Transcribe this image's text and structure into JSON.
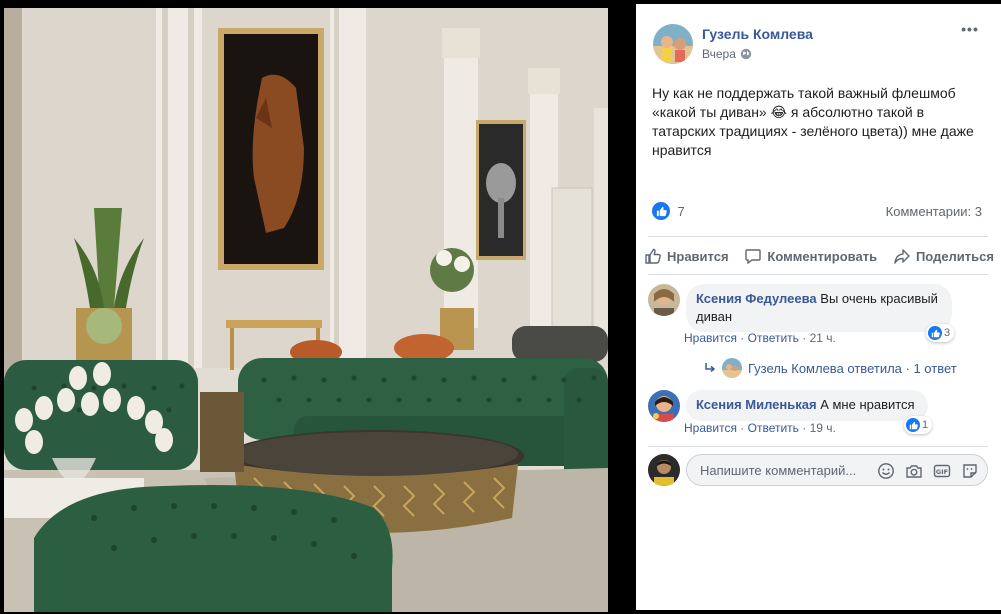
{
  "colors": {
    "link": "#385898",
    "like_blue": "#1877f2",
    "sofa_green": "#2d5a3f",
    "wall": "#ddd8cf",
    "gold": "#b08a48"
  },
  "photo": {
    "icons": [
      "sofa-photo"
    ]
  },
  "post": {
    "author": "Гузель Комлева",
    "time": "Вчера",
    "privacy_icon": "globe-icon",
    "more_label": "•••",
    "text": "Ну как не поддержать такой важный флешмоб «какой ты диван» 😂 я абсолютно такой в татарских традициях - зелёного цвета)) мне даже нравится",
    "reaction_count": "7",
    "comments_count": "Комментарии: 3"
  },
  "actions": {
    "like": "Нравится",
    "comment": "Комментировать",
    "share": "Поделиться"
  },
  "comments": [
    {
      "author": "Ксения Федулеева",
      "text_line1": "Вы очень красивый",
      "text_line2": "диван",
      "like_label": "Нравится",
      "reply_label": "Ответить",
      "sep": "·",
      "time": "21 ч.",
      "reactions": "3"
    },
    {
      "author": "Ксения Миленькая",
      "text": "А мне нравится",
      "like_label": "Нравится",
      "reply_label": "Ответить",
      "sep": "·",
      "time": "19 ч.",
      "reactions": "1"
    }
  ],
  "reply_summary": {
    "text": "Гузель Комлева ответила · 1 ответ"
  },
  "composer": {
    "placeholder": "Напишите комментарий..."
  }
}
